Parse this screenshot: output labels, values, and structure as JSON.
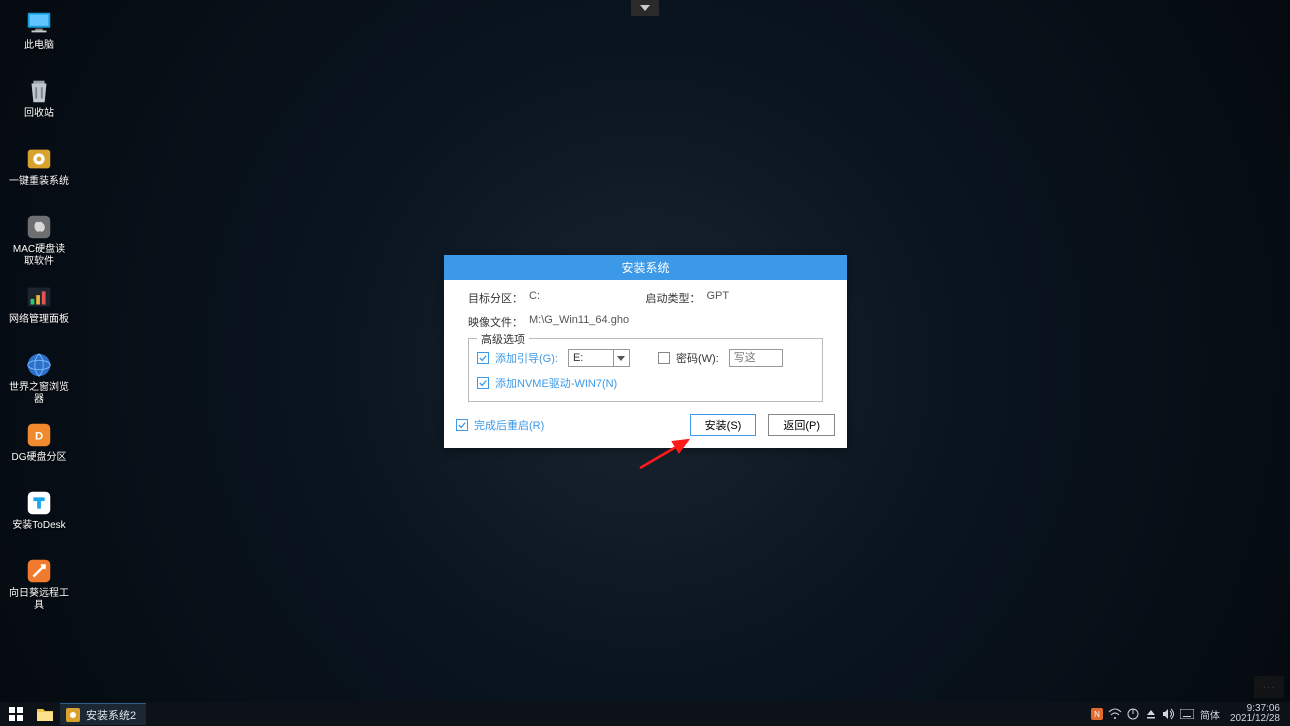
{
  "desktop_icons": [
    {
      "name": "this-pc",
      "label": "此电脑",
      "kind": "pc"
    },
    {
      "name": "recycle-bin",
      "label": "回收站",
      "kind": "bin"
    },
    {
      "name": "one-key-install",
      "label": "一键重装系统",
      "kind": "tool"
    },
    {
      "name": "mac-disk-reader",
      "label": "MAC硬盘读取软件",
      "kind": "mac"
    },
    {
      "name": "network-panel",
      "label": "网络管理面板",
      "kind": "net"
    },
    {
      "name": "world-browser",
      "label": "世界之窗浏览器",
      "kind": "globe"
    },
    {
      "name": "dg-partition",
      "label": "DG硬盘分区",
      "kind": "dg"
    },
    {
      "name": "install-todesk",
      "label": "安装ToDesk",
      "kind": "todesk"
    },
    {
      "name": "sunflower-remote",
      "label": "向日葵远程工具",
      "kind": "sunflower"
    }
  ],
  "dialog": {
    "title": "安装系统",
    "target_label": "目标分区：",
    "target_value": "C:",
    "boot_type_label": "启动类型：",
    "boot_type_value": "GPT",
    "image_label": "映像文件：",
    "image_value": "M:\\G_Win11_64.gho",
    "adv_legend": "高级选项",
    "add_boot_label": "添加引导(G):",
    "add_boot_drive": "E:",
    "password_label": "密码(W):",
    "password_placeholder": "写这",
    "add_nvme_label": "添加NVME驱动-WIN7(N)",
    "restart_label": "完成后重启(R)",
    "install_btn": "安装(S)",
    "back_btn": "返回(P)"
  },
  "taskbar": {
    "task_app": "安装系统2",
    "ime": "简体",
    "time": "9:37:06",
    "date": "2021/12/28"
  }
}
